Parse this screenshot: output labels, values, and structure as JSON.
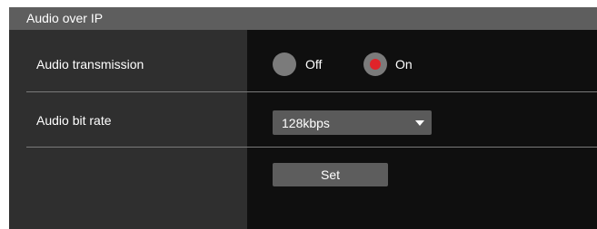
{
  "header": {
    "title": "Audio over IP"
  },
  "rows": {
    "audio_transmission": {
      "label": "Audio transmission",
      "options": [
        {
          "label": "Off",
          "selected": false
        },
        {
          "label": "On",
          "selected": true
        }
      ]
    },
    "audio_bit_rate": {
      "label": "Audio bit rate",
      "value": "128kbps"
    }
  },
  "actions": {
    "set_label": "Set"
  },
  "colors": {
    "accent": "#e0242a",
    "panel_background": "#0f0f0f",
    "label_column": "#2f2f2f",
    "header_bar": "#5e5e5e",
    "control": "#5a5a5a"
  },
  "icons": {
    "dropdown": "chevron-down-icon",
    "radio": "radio-icon"
  }
}
